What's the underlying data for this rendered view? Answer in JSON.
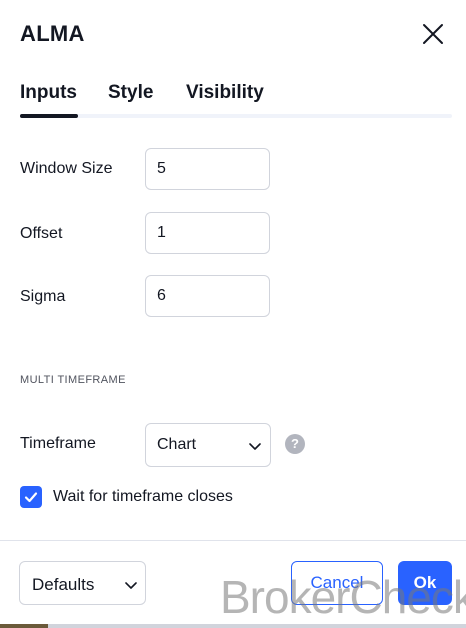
{
  "dialog": {
    "title": "ALMA",
    "close_icon": "close-icon"
  },
  "tabs": [
    {
      "label": "Inputs",
      "active": true
    },
    {
      "label": "Style",
      "active": false
    },
    {
      "label": "Visibility",
      "active": false
    }
  ],
  "inputs": {
    "window_size": {
      "label": "Window Size",
      "value": "5"
    },
    "offset": {
      "label": "Offset",
      "value": "1"
    },
    "sigma": {
      "label": "Sigma",
      "value": "6"
    }
  },
  "multi_timeframe": {
    "section_title": "MULTI TIMEFRAME",
    "timeframe_label": "Timeframe",
    "timeframe_value": "Chart",
    "help_glyph": "?",
    "wait_checkbox": {
      "label": "Wait for timeframe closes",
      "checked": true
    }
  },
  "footer": {
    "defaults_label": "Defaults",
    "cancel_label": "Cancel",
    "ok_label": "Ok"
  },
  "watermark": "BrokerCheck",
  "colors": {
    "accent": "#2962ff",
    "text": "#131722",
    "border": "#d1d4dc",
    "muted": "#b2b5be"
  }
}
